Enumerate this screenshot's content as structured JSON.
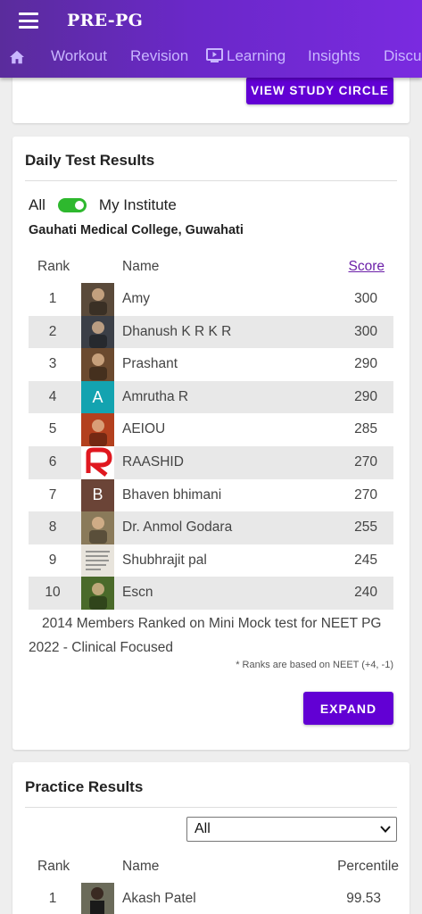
{
  "header": {
    "title": "PRE-PG",
    "tabs": [
      "Workout",
      "Revision",
      "Learning",
      "Insights",
      "Discu"
    ]
  },
  "study_circle": {
    "button": "VIEW STUDY CIRCLE"
  },
  "daily": {
    "title": "Daily Test Results",
    "toggle_left": "All",
    "toggle_right": "My Institute",
    "institute": "Gauhati Medical College, Guwahati",
    "headers": {
      "rank": "Rank",
      "name": "Name",
      "score": "Score"
    },
    "rows": [
      {
        "rank": "1",
        "name": "Amy",
        "score": "300",
        "avatar": "photo",
        "color": "#5a4a3a"
      },
      {
        "rank": "2",
        "name": "Dhanush K R K R",
        "score": "300",
        "avatar": "photo",
        "color": "#3b3f47"
      },
      {
        "rank": "3",
        "name": "Prashant",
        "score": "290",
        "avatar": "photo",
        "color": "#6b4a2f"
      },
      {
        "rank": "4",
        "name": "Amrutha R",
        "score": "290",
        "avatar": "A",
        "color": "#13a3b0"
      },
      {
        "rank": "5",
        "name": "AEIOU",
        "score": "285",
        "avatar": "photo",
        "color": "#b3401e"
      },
      {
        "rank": "6",
        "name": "RAASHID",
        "score": "270",
        "avatar": "logo",
        "color": "#e0171f"
      },
      {
        "rank": "7",
        "name": "Bhaven bhimani",
        "score": "270",
        "avatar": "B",
        "color": "#6b4437"
      },
      {
        "rank": "8",
        "name": "Dr. Anmol Godara",
        "score": "255",
        "avatar": "photo",
        "color": "#8a7a5a"
      },
      {
        "rank": "9",
        "name": "Shubhrajit pal",
        "score": "245",
        "avatar": "quote",
        "color": "#e8e4dc"
      },
      {
        "rank": "10",
        "name": "Escn",
        "score": "240",
        "avatar": "photo",
        "color": "#4a6a2a"
      }
    ],
    "members_line1": "2014  Members Ranked on Mini Mock test for NEET PG",
    "members_line2": "2022 - Clinical Focused",
    "note": "* Ranks are based on NEET (+4, -1)",
    "expand": "EXPAND"
  },
  "practice": {
    "title": "Practice Results",
    "select_value": "All",
    "headers": {
      "rank": "Rank",
      "name": "Name",
      "percentile": "Percentile"
    },
    "rows": [
      {
        "rank": "1",
        "name": "Akash Patel",
        "percentile": "99.53"
      }
    ]
  },
  "colors": {
    "primary": "#6200d4",
    "header": "#6a28c8",
    "toggle": "#2eb82e"
  }
}
